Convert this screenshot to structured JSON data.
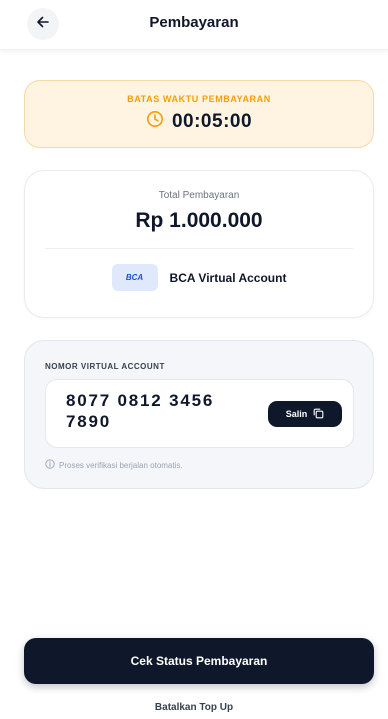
{
  "header": {
    "title": "Pembayaran",
    "back_icon": "arrow-left-icon"
  },
  "timer": {
    "label": "BATAS WAKTU PEMBAYARAN",
    "value": "00:05:00",
    "icon": "clock-icon",
    "accent_color": "#f59e0b"
  },
  "total": {
    "label": "Total Pembayaran",
    "amount": "Rp 1.000.000",
    "bank_logo_text": "BCA",
    "bank_name": "BCA Virtual Account"
  },
  "virtual_account": {
    "label": "NOMOR VIRTUAL ACCOUNT",
    "number": "8077 0812 3456 7890",
    "copy_label": "Salin",
    "copy_icon": "copy-icon",
    "hint_icon": "info-icon",
    "hint": "Proses verifikasi berjalan otomatis."
  },
  "actions": {
    "primary_label": "Cek Status Pembayaran",
    "secondary_label": "Batalkan Top Up"
  },
  "colors": {
    "primary": "#0f172a",
    "timer_bg": "#fef4e1",
    "timer_border": "#f7d9a3"
  }
}
